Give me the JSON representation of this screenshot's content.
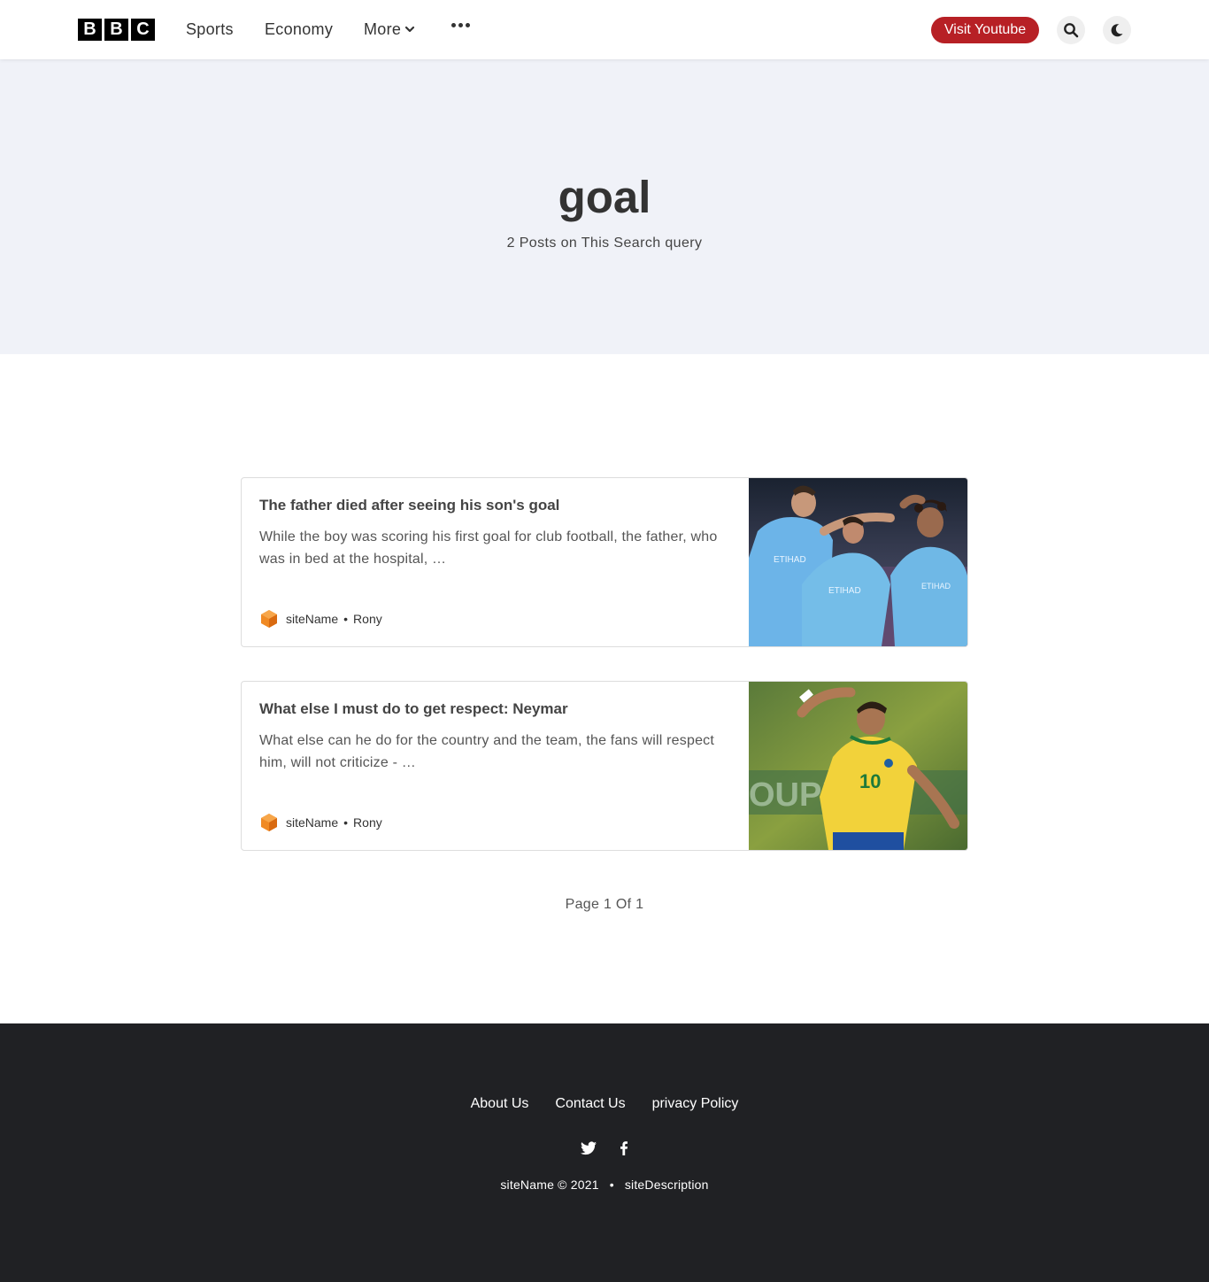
{
  "header": {
    "logo_letters": [
      "B",
      "B",
      "C"
    ],
    "nav": {
      "sports": "Sports",
      "economy": "Economy",
      "more": "More"
    },
    "youtube_button": "Visit Youtube"
  },
  "hero": {
    "title": "goal",
    "subtitle": "2 Posts on This Search query"
  },
  "posts": [
    {
      "title": "The father died after seeing his son's goal",
      "excerpt": "While the boy was scoring his first goal for club football, the father, who was in bed at the hospital, …",
      "site": "siteName",
      "separator": "•",
      "author": "Rony"
    },
    {
      "title": "What else I must do to get respect: Neymar",
      "excerpt": "What else can he do for the country and the team, the fans will respect him, will not criticize - …",
      "site": "siteName",
      "separator": "•",
      "author": "Rony"
    }
  ],
  "pagination": "Page 1 Of 1",
  "footer": {
    "links": {
      "about": "About Us",
      "contact": "Contact Us",
      "privacy": "privacy Policy"
    },
    "copyright": "siteName © 2021",
    "bullet": "•",
    "description": "siteDescription"
  },
  "colors": {
    "accent": "#b72025",
    "hero_bg": "#f0f2f8",
    "footer_bg": "#202124"
  }
}
